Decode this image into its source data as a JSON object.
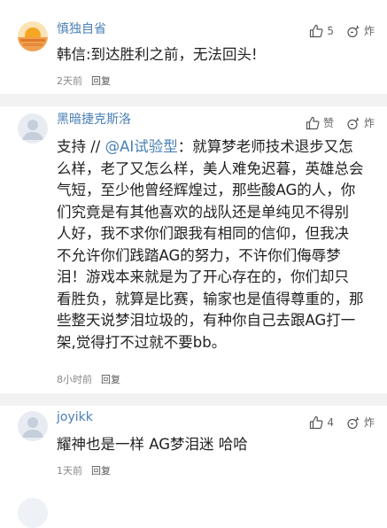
{
  "comments": [
    {
      "username": "慎独自省",
      "like_count": "5",
      "dislike_label": "炸",
      "text": "韩信:到达胜利之前，无法回头!",
      "time": "2天前",
      "reply": "回复"
    },
    {
      "username": "黑暗捷克斯洛",
      "like_label": "赞",
      "dislike_label": "炸",
      "text_prefix": "支持 // ",
      "mention": "@AI试验型",
      "text_lines": [
        "：就算梦老师技术退步又怎",
        "么样，老了又怎么样，美人难免迟暮，英雄总会",
        "气短，至少他曾经辉煌过，那些酸AG的人，你",
        "们究竟是有其他喜欢的战队还是单纯见不得别",
        "人好，我不求你们跟我有相同的信仰，但我决",
        "不允许你们践踏AG的努力，不许你们侮辱梦",
        "泪！游戏本来就是为了开心存在的，你们却只",
        "看胜负，就算是比赛，输家也是值得尊重的，那",
        "些整天说梦泪垃圾的，有种你自己去跟AG打一",
        "架,觉得打不过就不要bb。"
      ],
      "time": "8小时前",
      "reply": "回复"
    },
    {
      "username": "joyikk",
      "like_count": "4",
      "dislike_label": "炸",
      "text": "耀神也是一样 AG梦泪迷 哈哈",
      "time": "1天前",
      "reply": "回复"
    }
  ]
}
